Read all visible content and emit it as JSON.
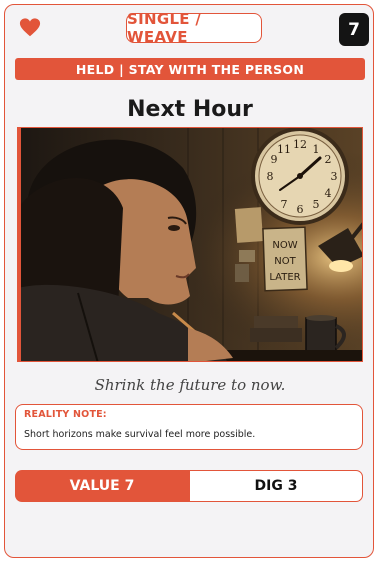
{
  "card": {
    "type_label": "SINGLE / WEAVE",
    "cost": "7",
    "banner": "HELD | STAY WITH THE PERSON",
    "title": "Next Hour",
    "quote": "Shrink the future to now.",
    "note_label": "REALITY NOTE:",
    "note_text": "Short horizons make survival feel more possible.",
    "value_label": "VALUE 7",
    "dig_label": "DIG 3"
  },
  "art": {
    "sign_text": [
      "NOW",
      "NOT",
      "LATER"
    ],
    "clock_numerals": [
      "11",
      "12",
      "1",
      "2",
      "3",
      "4",
      "5",
      "6",
      "7",
      "8",
      "9",
      "10"
    ]
  },
  "colors": {
    "accent": "#e2553a",
    "cost_bg": "#141414",
    "card_bg": "#f4f3f5"
  },
  "icons": {
    "suit": "heart-icon"
  }
}
